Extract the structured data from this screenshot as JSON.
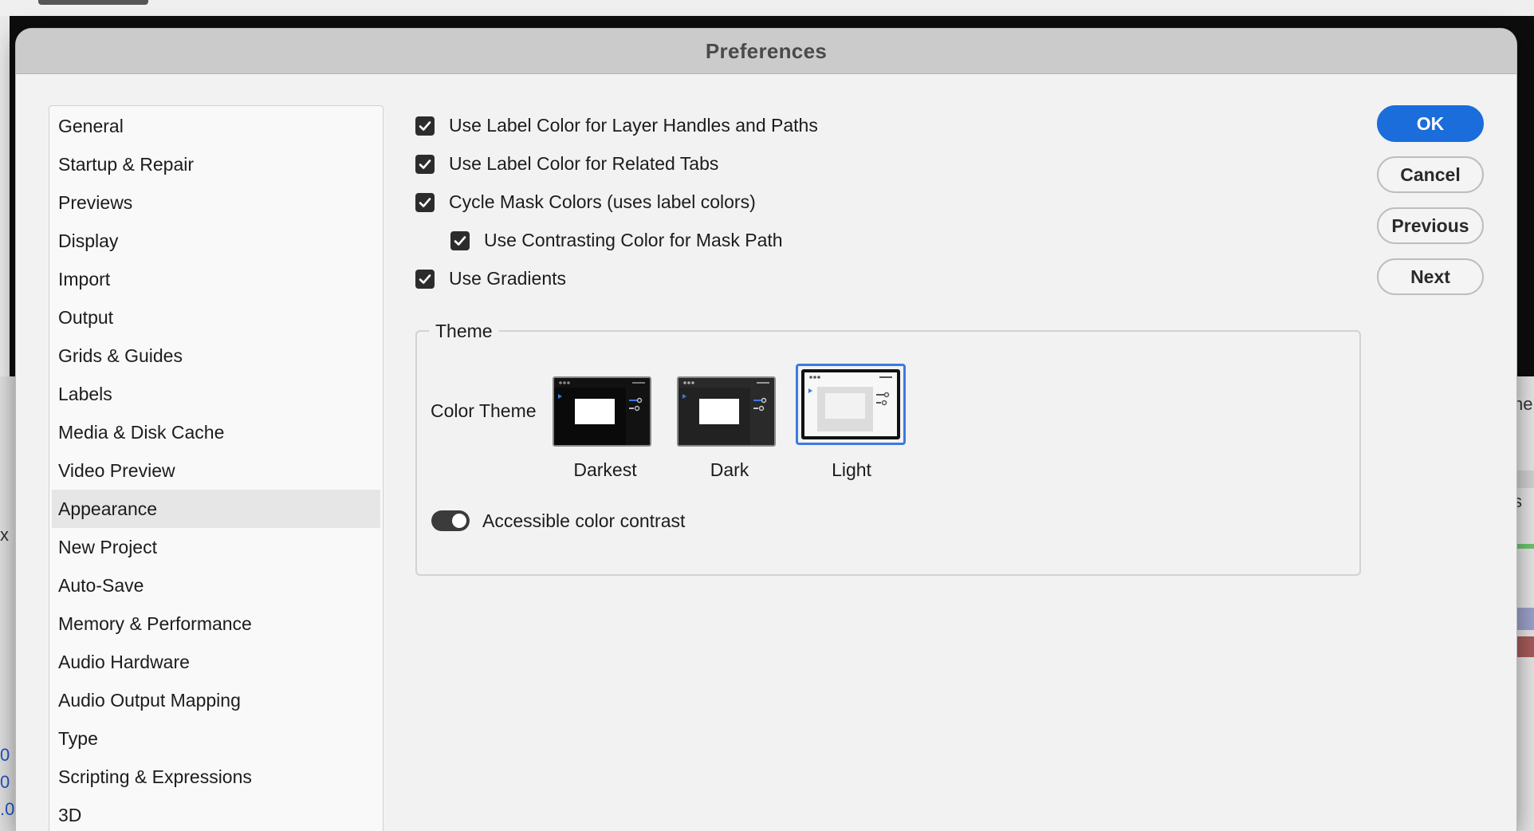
{
  "dialog": {
    "title": "Preferences"
  },
  "categories": [
    {
      "label": "General"
    },
    {
      "label": "Startup & Repair"
    },
    {
      "label": "Previews"
    },
    {
      "label": "Display"
    },
    {
      "label": "Import"
    },
    {
      "label": "Output"
    },
    {
      "label": "Grids & Guides"
    },
    {
      "label": "Labels"
    },
    {
      "label": "Media & Disk Cache"
    },
    {
      "label": "Video Preview"
    },
    {
      "label": "Appearance",
      "selected": true
    },
    {
      "label": "New Project"
    },
    {
      "label": "Auto-Save"
    },
    {
      "label": "Memory & Performance"
    },
    {
      "label": "Audio Hardware"
    },
    {
      "label": "Audio Output Mapping"
    },
    {
      "label": "Type"
    },
    {
      "label": "Scripting & Expressions"
    },
    {
      "label": "3D"
    }
  ],
  "options": [
    {
      "label": "Use Label Color for Layer Handles and Paths",
      "checked": true
    },
    {
      "label": "Use Label Color for Related Tabs",
      "checked": true
    },
    {
      "label": "Cycle Mask Colors (uses label colors)",
      "checked": true
    },
    {
      "label": "Use Contrasting Color for Mask Path",
      "checked": true
    },
    {
      "label": "Use Gradients",
      "checked": true
    }
  ],
  "theme": {
    "legend": "Theme",
    "color_theme_label": "Color Theme",
    "themes": [
      {
        "name": "Darkest",
        "selected": false
      },
      {
        "name": "Dark",
        "selected": false
      },
      {
        "name": "Light",
        "selected": true
      }
    ],
    "accessible_contrast_label": "Accessible color contrast",
    "accessible_contrast_on": true
  },
  "buttons": {
    "ok": "OK",
    "cancel": "Cancel",
    "previous": "Previous",
    "next": "Next"
  },
  "background": {
    "right_text_1": "ne",
    "right_text_2": "s",
    "left_text_1": "x",
    "left_text_2": "0",
    "left_text_3": "0",
    "left_text_4": ".0"
  },
  "colors": {
    "accent": "#1a6ddb",
    "selection_border": "#3a7be0"
  }
}
